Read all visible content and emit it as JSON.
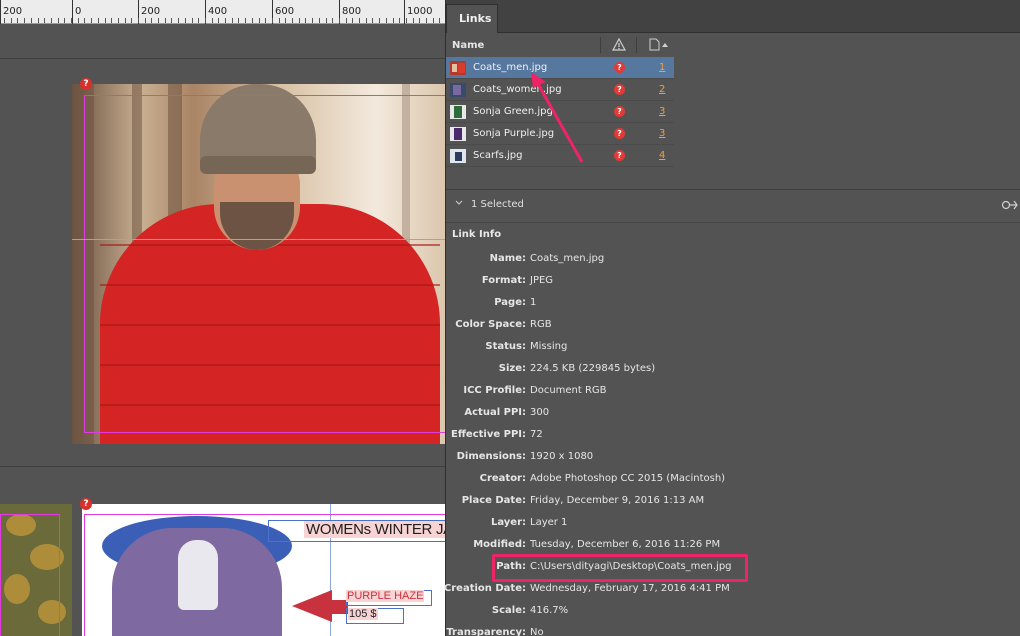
{
  "ruler": {
    "labels": [
      "200",
      "0",
      "200",
      "400",
      "600",
      "800",
      "1000"
    ]
  },
  "canvas": {
    "missing_badge": "?",
    "ad": {
      "title": "WOMENs WINTER JA",
      "product_name": "PURPLE HAZE",
      "price": "105 $"
    }
  },
  "panel": {
    "tab_label": "Links",
    "columns": {
      "name": "Name",
      "status_icon": "warning-triangle-icon",
      "page_icon": "page-sort-icon"
    },
    "links": [
      {
        "name": "Coats_men.jpg",
        "page": "1",
        "selected": true,
        "status": "?"
      },
      {
        "name": "Coats_women.jpg",
        "page": "2",
        "selected": false,
        "status": "?"
      },
      {
        "name": "Sonja Green.jpg",
        "page": "3",
        "selected": false,
        "status": "?"
      },
      {
        "name": "Sonja Purple.jpg",
        "page": "3",
        "selected": false,
        "status": "?"
      },
      {
        "name": "Scarfs.jpg",
        "page": "4",
        "selected": false,
        "status": "?"
      }
    ],
    "selection_summary": "1 Selected",
    "link_info": {
      "title": "Link Info",
      "fields": [
        {
          "label": "Name:",
          "value": "Coats_men.jpg"
        },
        {
          "label": "Format:",
          "value": "JPEG"
        },
        {
          "label": "Page:",
          "value": "1"
        },
        {
          "label": "Color Space:",
          "value": "RGB"
        },
        {
          "label": "Status:",
          "value": "Missing"
        },
        {
          "label": "Size:",
          "value": "224.5 KB (229845 bytes)"
        },
        {
          "label": "ICC Profile:",
          "value": "Document RGB"
        },
        {
          "label": "Actual PPI:",
          "value": "300"
        },
        {
          "label": "Effective PPI:",
          "value": "72"
        },
        {
          "label": "Dimensions:",
          "value": "1920 x 1080"
        },
        {
          "label": "Creator:",
          "value": "Adobe Photoshop CC 2015 (Macintosh)"
        },
        {
          "label": "Place Date:",
          "value": "Friday, December 9, 2016 1:13 AM"
        },
        {
          "label": "Layer:",
          "value": "Layer 1"
        },
        {
          "label": "Modified:",
          "value": "Tuesday, December 6, 2016 11:26 PM"
        },
        {
          "label": "Path:",
          "value": "C:\\Users\\dityagi\\Desktop\\Coats_men.jpg"
        },
        {
          "label": "Creation Date:",
          "value": "Wednesday, February 17, 2016 4:41 PM"
        },
        {
          "label": "Scale:",
          "value": "416.7%"
        },
        {
          "label": "Transparency:",
          "value": "No"
        }
      ]
    }
  },
  "colors": {
    "selection": "#56779e",
    "missing": "#e23a36",
    "page_link": "#f0a03a",
    "annotation": "#ee2466"
  }
}
